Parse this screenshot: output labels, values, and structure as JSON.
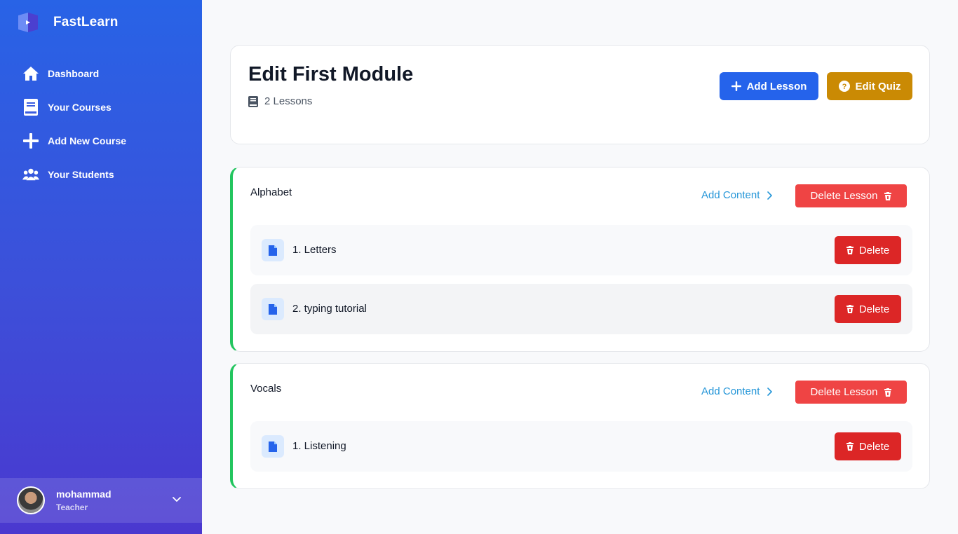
{
  "app": {
    "name": "FastLearn"
  },
  "sidebar": {
    "items": [
      {
        "label": "Dashboard",
        "icon": "home-icon"
      },
      {
        "label": "Your Courses",
        "icon": "book-icon"
      },
      {
        "label": "Add New Course",
        "icon": "plus-icon"
      },
      {
        "label": "Your Students",
        "icon": "users-icon"
      }
    ],
    "user": {
      "name": "mohammad",
      "role": "Teacher"
    }
  },
  "header": {
    "title": "Edit First Module",
    "lesson_count": "2 Lessons",
    "add_lesson_label": "Add Lesson",
    "edit_quiz_label": "Edit Quiz"
  },
  "lessons": [
    {
      "title": "Alphabet",
      "add_content_label": "Add Content",
      "delete_lesson_label": "Delete Lesson",
      "contents": [
        {
          "label": "1. Letters",
          "delete_label": "Delete"
        },
        {
          "label": "2. typing tutorial",
          "delete_label": "Delete"
        }
      ]
    },
    {
      "title": "Vocals",
      "add_content_label": "Add Content",
      "delete_lesson_label": "Delete Lesson",
      "contents": [
        {
          "label": "1. Listening",
          "delete_label": "Delete"
        }
      ]
    }
  ],
  "colors": {
    "primary": "#2563eb",
    "quiz": "#ca8a04",
    "danger": "#dc2626",
    "danger_light": "#ef4444",
    "accent_border": "#22c55e",
    "link": "#2596d8"
  }
}
